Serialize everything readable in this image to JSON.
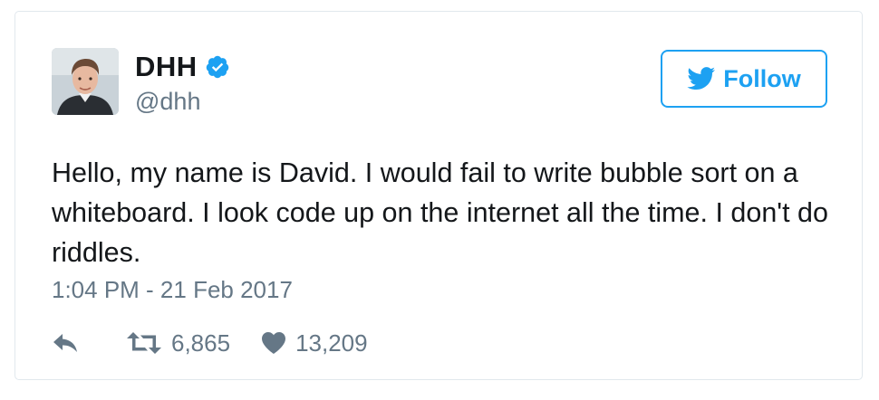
{
  "author": {
    "display_name": "DHH",
    "handle": "@dhh",
    "verified": true
  },
  "follow_button": {
    "label": "Follow",
    "icon": "twitter-bird-icon"
  },
  "tweet": {
    "text": "Hello, my name is David. I would fail to write bubble sort on a whiteboard. I look code up on the internet all the time. I don't do riddles.",
    "timestamp": "1:04 PM - 21 Feb 2017"
  },
  "actions": {
    "reply_icon": "reply-icon",
    "retweet_icon": "retweet-icon",
    "retweet_count": "6,865",
    "like_icon": "heart-icon",
    "like_count": "13,209"
  },
  "colors": {
    "accent": "#1da1f2",
    "text_primary": "#14171a",
    "text_secondary": "#657786",
    "border": "#e1e8ed"
  }
}
